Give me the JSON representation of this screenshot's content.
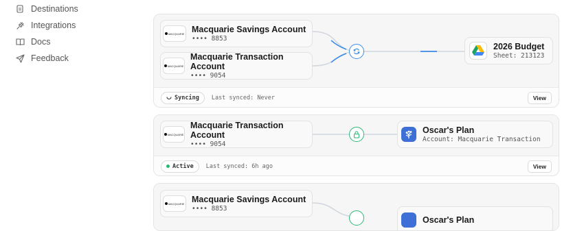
{
  "sidebar": {
    "items": [
      {
        "label": "Destinations",
        "icon": "file-icon"
      },
      {
        "label": "Integrations",
        "icon": "plug-icon"
      },
      {
        "label": "Docs",
        "icon": "book-icon"
      },
      {
        "label": "Feedback",
        "icon": "send-icon"
      }
    ]
  },
  "syncs": [
    {
      "sources": [
        {
          "logo": "MACQUARIE",
          "name": "Macquarie Savings Account",
          "sub": "•••• 8853"
        },
        {
          "logo": "MACQUARIE",
          "name": "Macquarie Transaction Account",
          "sub": "•••• 9054"
        }
      ],
      "destination": {
        "name": "2026 Budget",
        "sub": "Sheet: 213123",
        "icon": "google-drive-icon"
      },
      "node_icon": "sync-icon",
      "status": "Syncing",
      "last_synced": "Last synced: Never",
      "view_label": "View",
      "accent": "#3b8be8"
    },
    {
      "sources": [
        {
          "logo": "MACQUARIE",
          "name": "Macquarie Transaction Account",
          "sub": "•••• 9054"
        }
      ],
      "destination": {
        "name": "Oscar's Plan",
        "sub": "Account: Macquarie Transaction",
        "icon": "tree-icon"
      },
      "node_icon": "lock-icon",
      "status": "Active",
      "last_synced": "Last synced: 6h ago",
      "view_label": "View",
      "accent": "#2bb673"
    },
    {
      "sources": [
        {
          "logo": "MACQUARIE",
          "name": "Macquarie Savings Account",
          "sub": "•••• 8853"
        }
      ],
      "destination": {
        "name": "Oscar's Plan",
        "icon": "tree-icon"
      },
      "node_icon": "lock-icon",
      "accent": "#2bb673"
    }
  ]
}
